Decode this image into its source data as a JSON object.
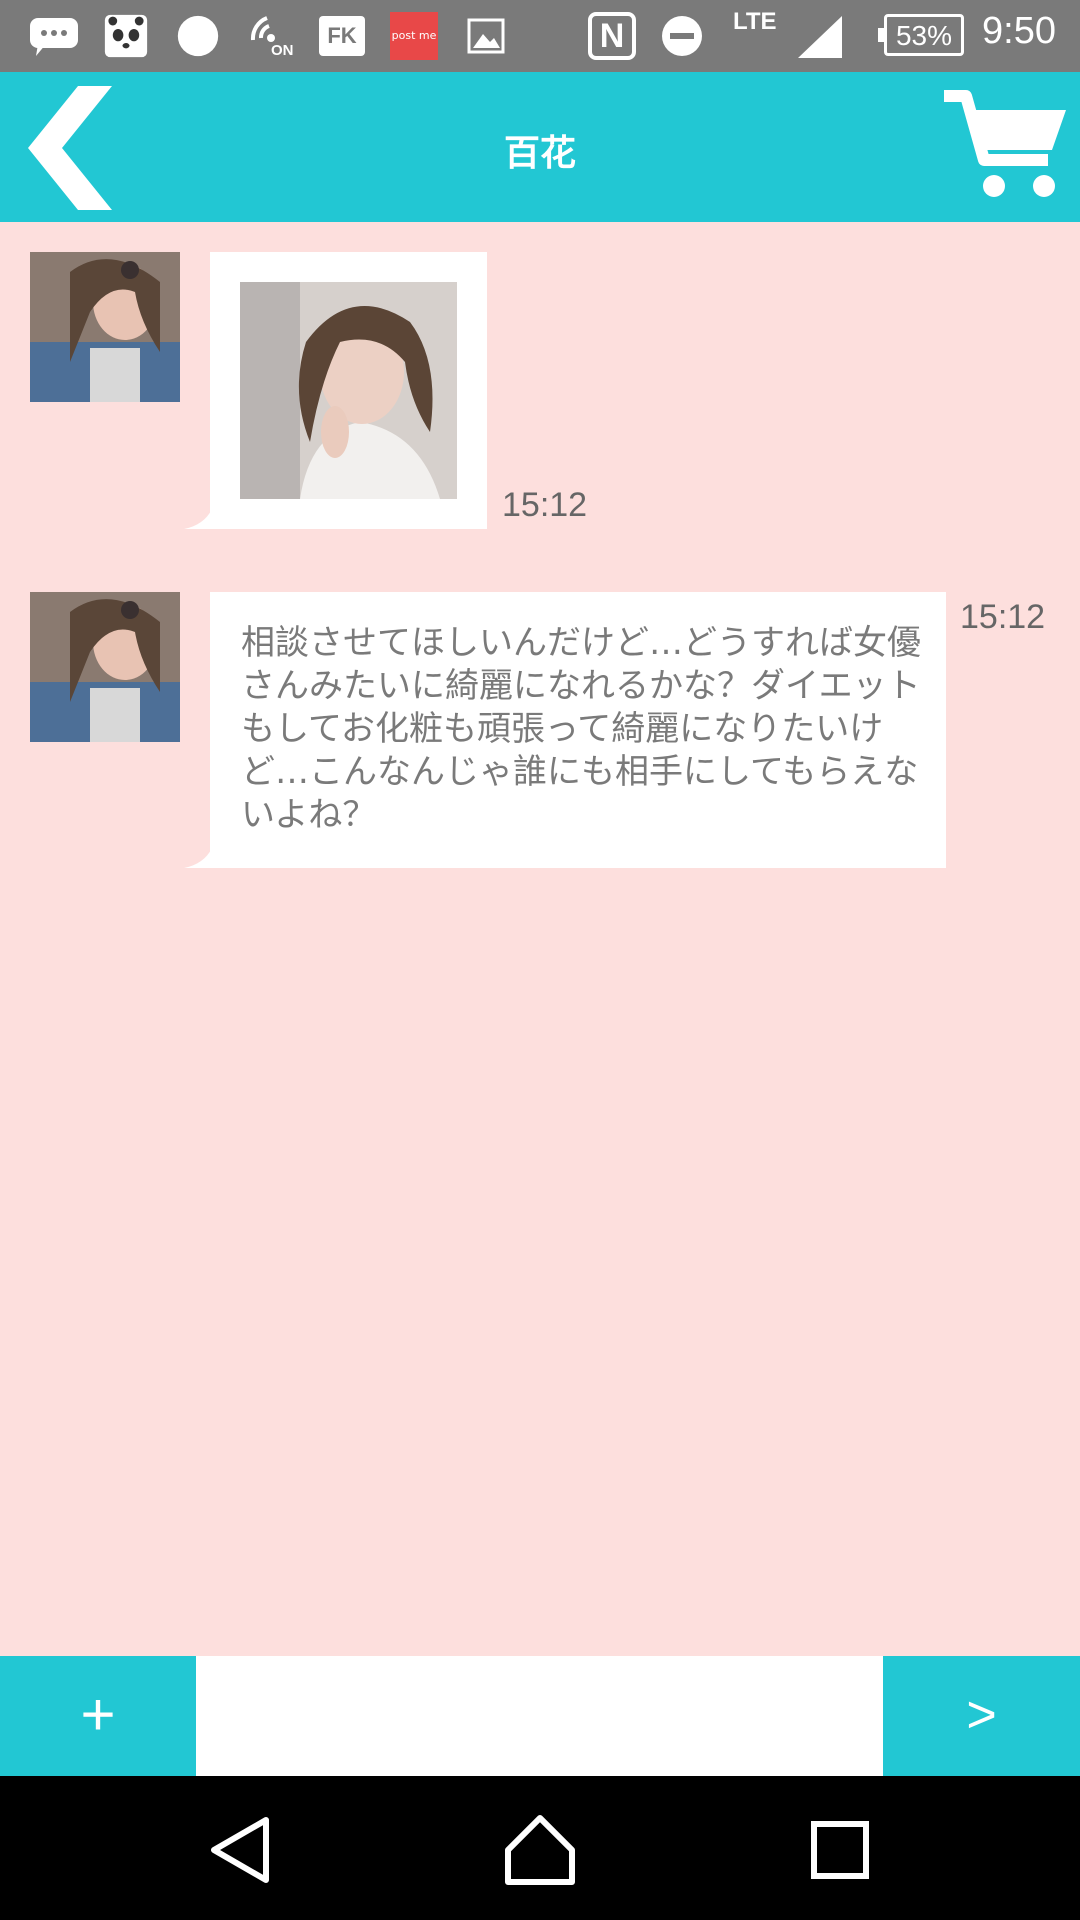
{
  "status_bar": {
    "time": "9:50",
    "battery": "53%",
    "network": "LTE",
    "nfc_symbol": "N",
    "postme_label": "post me",
    "fk_label": "FK",
    "on_label": "ON",
    "icons": [
      "chat-bubble-icon",
      "panda-icon",
      "circle-icon",
      "wireless-on-icon",
      "fk-app-icon",
      "postme-app-icon",
      "image-icon",
      "nfc-icon",
      "do-not-disturb-icon",
      "signal-icon",
      "battery-icon"
    ]
  },
  "header": {
    "title": "百花",
    "back_icon": "chevron-left-icon",
    "cart_icon": "cart-icon"
  },
  "messages": [
    {
      "type": "image",
      "time": "15:12",
      "avatar": "avatar-icon"
    },
    {
      "type": "text",
      "time": "15:12",
      "text": "相談させてほしいんだけど…どうすれば女優さんみたいに綺麗になれるかな？ダイエットもしてお化粧も頑張って綺麗になりたいけど…こんなんじゃ誰にも相手にしてもらえないよね？"
    }
  ],
  "input_bar": {
    "plus_label": "+",
    "send_label": ">",
    "placeholder": "",
    "value": ""
  },
  "colors": {
    "accent": "#22c7d3",
    "background": "#fddfdd",
    "status_bar": "#7a7a7a"
  }
}
